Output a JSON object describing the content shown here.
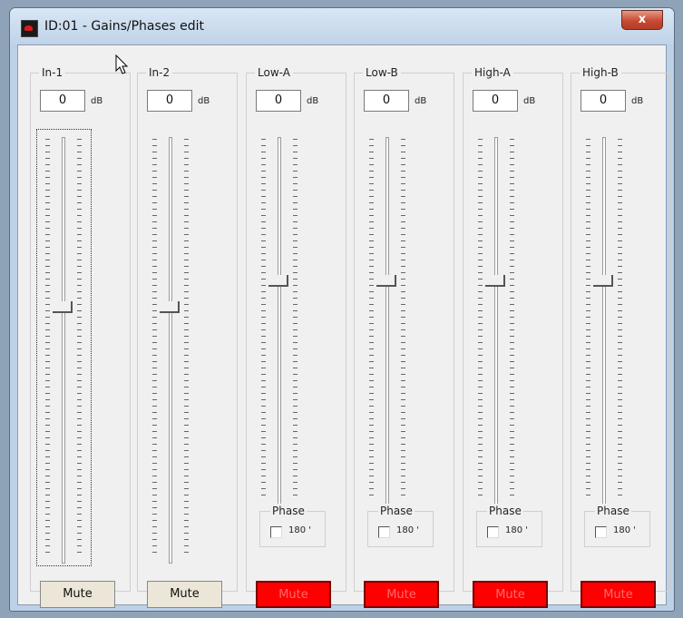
{
  "window": {
    "title": "ID:01 - Gains/Phases edit",
    "close_label": "x"
  },
  "channels": [
    {
      "name": "In-1",
      "gain": "0",
      "unit": "dB",
      "mute": "Mute",
      "mute_active": false,
      "has_phase": false
    },
    {
      "name": "In-2",
      "gain": "0",
      "unit": "dB",
      "mute": "Mute",
      "mute_active": false,
      "has_phase": false
    },
    {
      "name": "Low-A",
      "gain": "0",
      "unit": "dB",
      "mute": "Mute",
      "mute_active": true,
      "has_phase": true,
      "phase_label": "Phase",
      "phase_option": "180 '"
    },
    {
      "name": "Low-B",
      "gain": "0",
      "unit": "dB",
      "mute": "Mute",
      "mute_active": true,
      "has_phase": true,
      "phase_label": "Phase",
      "phase_option": "180 '"
    },
    {
      "name": "High-A",
      "gain": "0",
      "unit": "dB",
      "mute": "Mute",
      "mute_active": true,
      "has_phase": true,
      "phase_label": "Phase",
      "phase_option": "180 '"
    },
    {
      "name": "High-B",
      "gain": "0",
      "unit": "dB",
      "mute": "Mute",
      "mute_active": true,
      "has_phase": true,
      "phase_label": "Phase",
      "phase_option": "180 '"
    }
  ],
  "colors": {
    "mute_active": "#ff0000",
    "mute_inactive": "#ebe6d7"
  }
}
